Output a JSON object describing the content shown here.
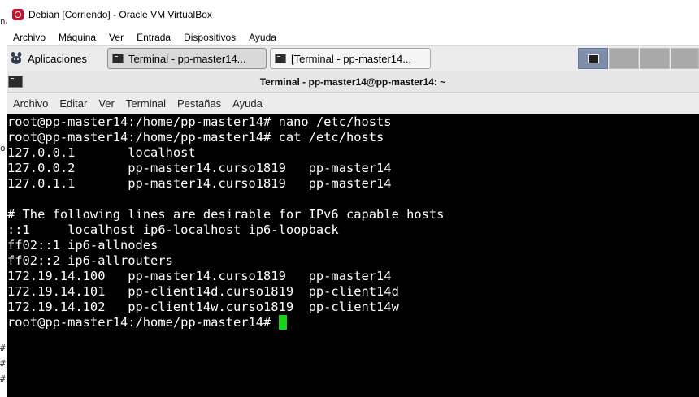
{
  "desktop": {
    "edge_text": [
      "na",
      "or",
      "#",
      "#",
      "#"
    ]
  },
  "vbox": {
    "title": "Debian [Corriendo] - Oracle VM VirtualBox",
    "menu": [
      "Archivo",
      "Máquina",
      "Ver",
      "Entrada",
      "Dispositivos",
      "Ayuda"
    ]
  },
  "panel": {
    "apps_label": "Aplicaciones",
    "tasks": [
      "Terminal - pp-master14...",
      "[Terminal - pp-master14..."
    ]
  },
  "terminal": {
    "title": "Terminal - pp-master14@pp-master14: ~",
    "menu": [
      "Archivo",
      "Editar",
      "Ver",
      "Terminal",
      "Pestañas",
      "Ayuda"
    ],
    "lines": [
      "root@pp-master14:/home/pp-master14# nano /etc/hosts",
      "root@pp-master14:/home/pp-master14# cat /etc/hosts",
      "127.0.0.1       localhost",
      "127.0.0.2       pp-master14.curso1819   pp-master14",
      "127.0.1.1       pp-master14.curso1819   pp-master14",
      "",
      "# The following lines are desirable for IPv6 capable hosts",
      "::1     localhost ip6-localhost ip6-loopback",
      "ff02::1 ip6-allnodes",
      "ff02::2 ip6-allrouters",
      "172.19.14.100   pp-master14.curso1819   pp-master14",
      "172.19.14.101   pp-client14d.curso1819  pp-client14d",
      "172.19.14.102   pp-client14w.curso1819  pp-client14w"
    ],
    "prompt": "root@pp-master14:/home/pp-master14# "
  }
}
